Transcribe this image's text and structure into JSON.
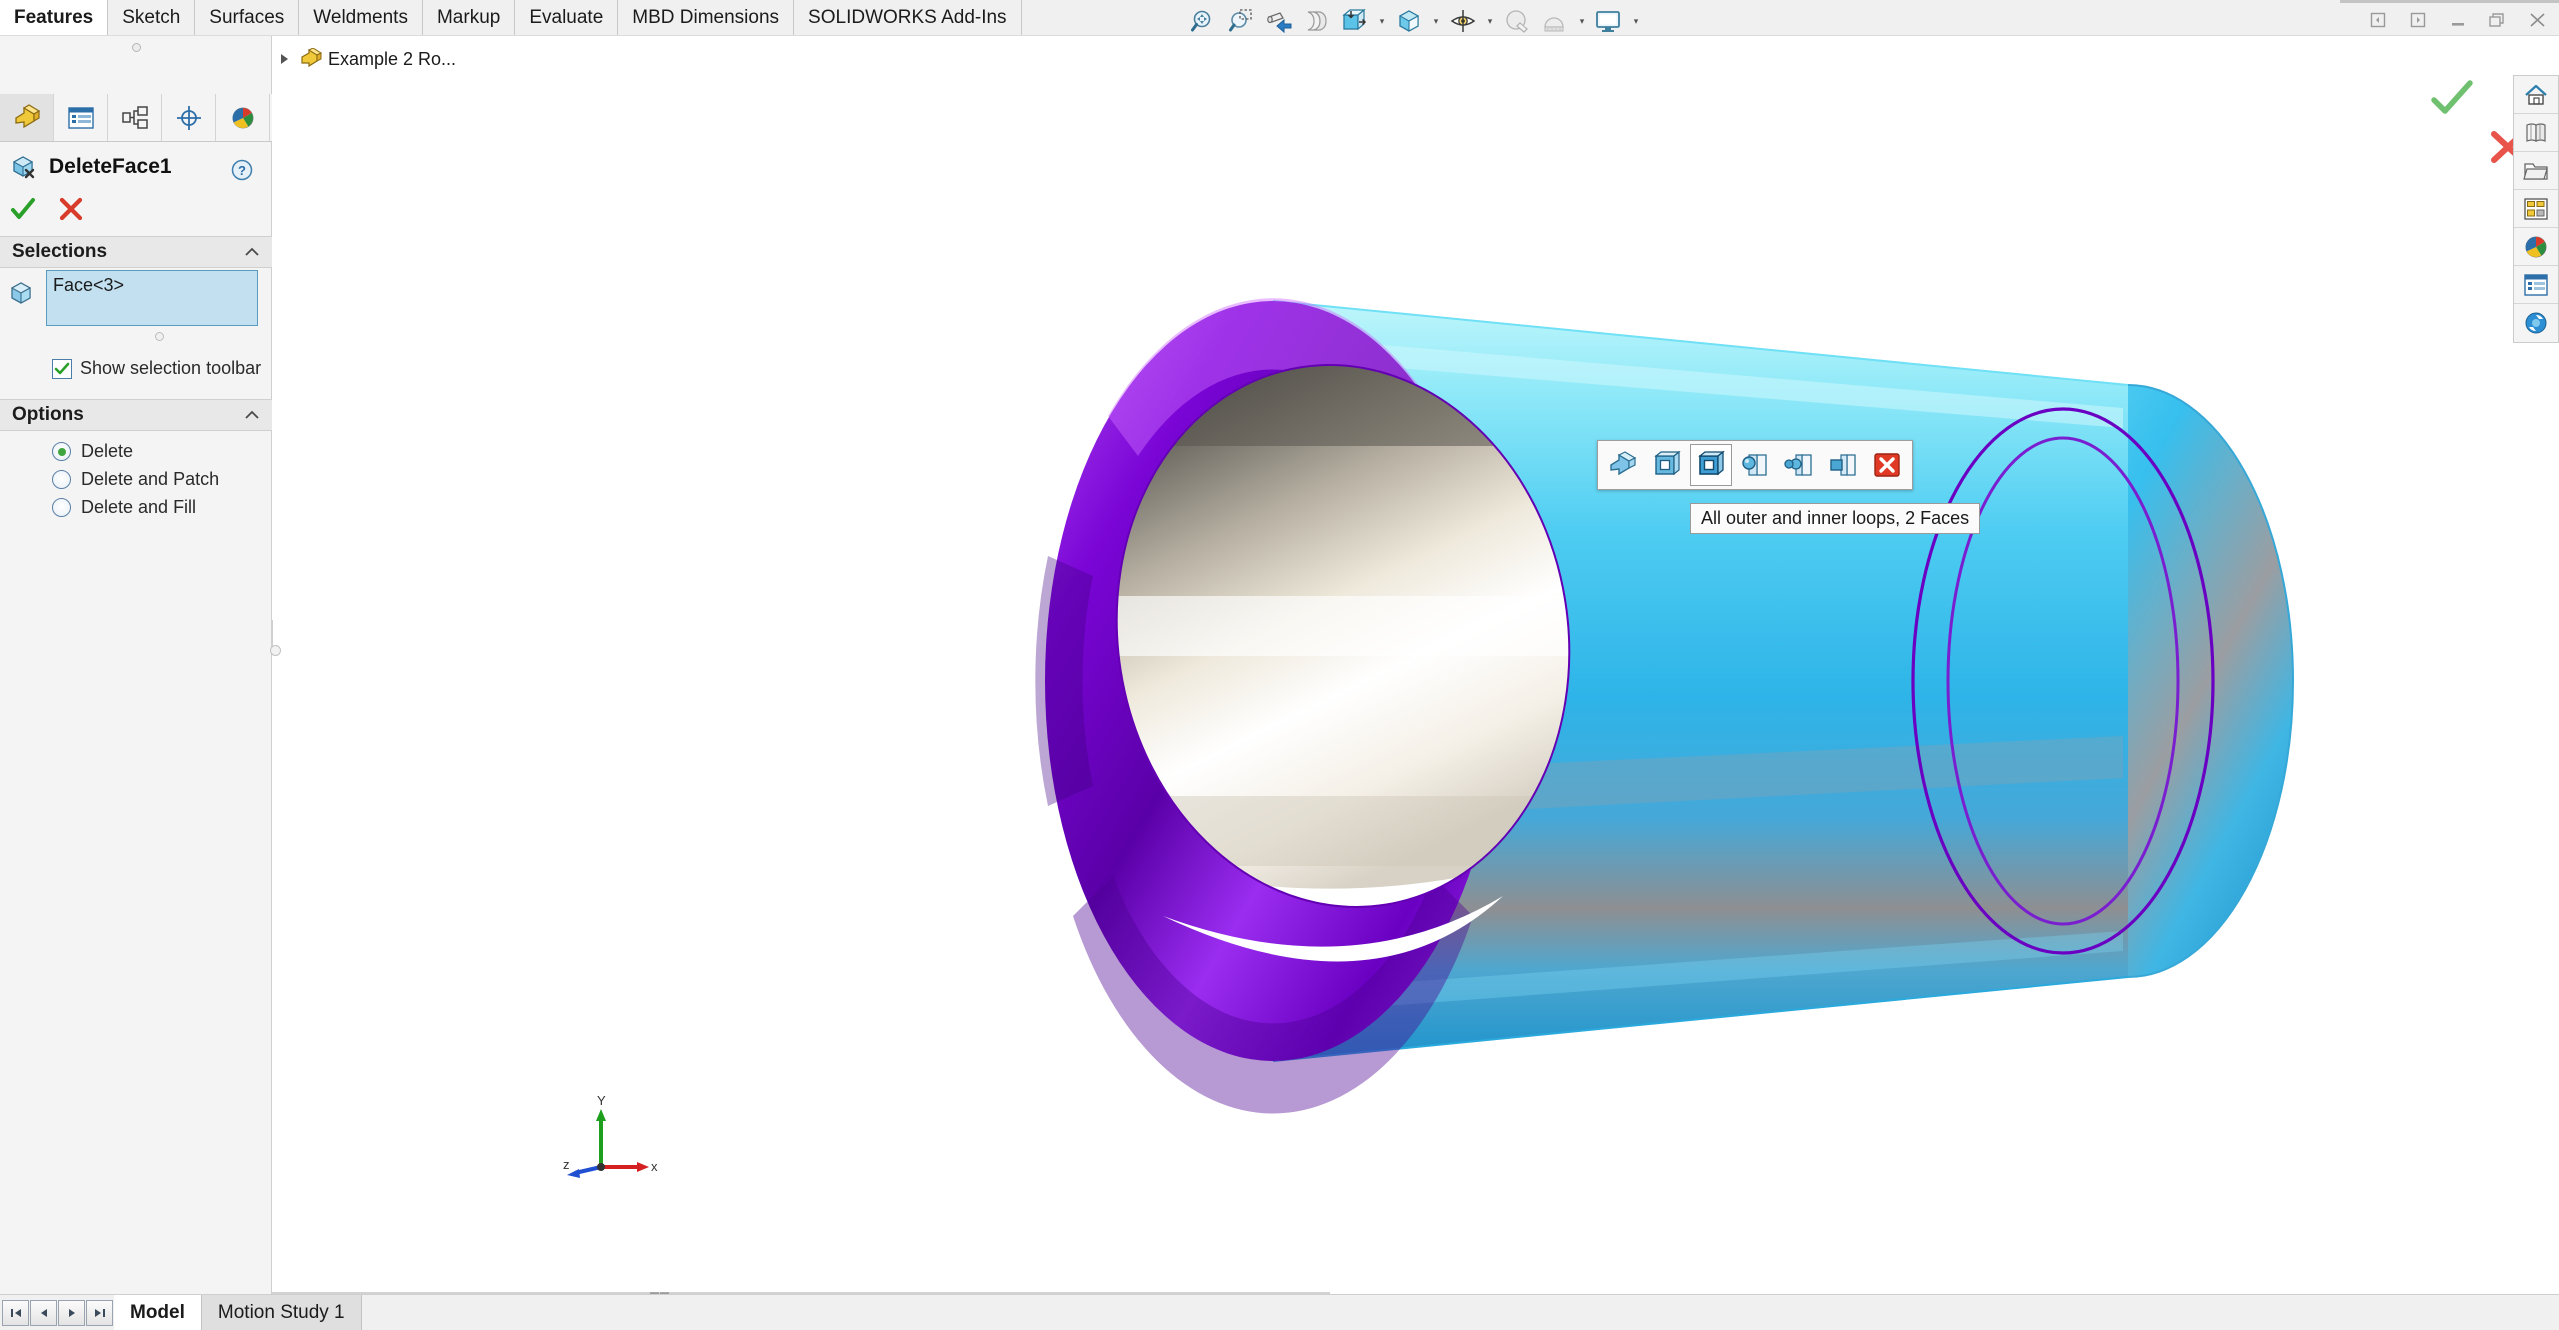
{
  "app": {
    "title": "SOLIDWORKS",
    "accent_color": "#2a6ea6"
  },
  "ribbon": {
    "tabs": [
      {
        "label": "Features",
        "active": true
      },
      {
        "label": "Sketch",
        "active": false
      },
      {
        "label": "Surfaces",
        "active": false
      },
      {
        "label": "Weldments",
        "active": false
      },
      {
        "label": "Markup",
        "active": false
      },
      {
        "label": "Evaluate",
        "active": false
      },
      {
        "label": "MBD Dimensions",
        "active": false
      },
      {
        "label": "SOLIDWORKS Add-Ins",
        "active": false
      }
    ]
  },
  "view_toolbar": {
    "buttons": [
      {
        "name": "zoom-to-fit-icon",
        "has_caret": false
      },
      {
        "name": "zoom-to-area-icon",
        "has_caret": false
      },
      {
        "name": "previous-view-icon",
        "has_caret": false
      },
      {
        "name": "section-view-icon",
        "has_caret": false
      },
      {
        "name": "view-orientation-icon",
        "has_caret": true
      },
      {
        "name": "display-style-icon",
        "has_caret": true
      },
      {
        "name": "hide-show-items-icon",
        "has_caret": true
      },
      {
        "name": "apply-scene-icon",
        "has_caret": false
      },
      {
        "name": "view-settings-icon",
        "has_caret": true
      },
      {
        "name": "viewport-layout-icon",
        "has_caret": true
      }
    ]
  },
  "window_controls": [
    {
      "name": "restore-left-icon",
      "label": ""
    },
    {
      "name": "restore-right-icon",
      "label": ""
    },
    {
      "name": "minimize-icon",
      "label": ""
    },
    {
      "name": "restore-down-icon",
      "label": ""
    },
    {
      "name": "close-icon",
      "label": ""
    }
  ],
  "property_manager": {
    "tabs": [
      {
        "name": "feature-manager-tab",
        "active": true
      },
      {
        "name": "property-manager-tab",
        "active": false
      },
      {
        "name": "configuration-manager-tab",
        "active": false
      },
      {
        "name": "dimxpert-manager-tab",
        "active": false
      },
      {
        "name": "display-manager-tab",
        "active": false
      }
    ],
    "title": "DeleteFace1",
    "help_label": "?",
    "confirm": {
      "ok_name": "ok-button",
      "cancel_name": "cancel-button"
    },
    "selections": {
      "header": "Selections",
      "face_value": "Face<3>",
      "show_selection_toolbar_label": "Show selection toolbar",
      "show_selection_toolbar_checked": true
    },
    "options": {
      "header": "Options",
      "items": [
        {
          "label": "Delete",
          "selected": true
        },
        {
          "label": "Delete and Patch",
          "selected": false
        },
        {
          "label": "Delete and Fill",
          "selected": false
        }
      ]
    }
  },
  "tree": {
    "item_label": "Example 2 Ro...",
    "expander": "▶"
  },
  "context_toolbar": {
    "buttons": [
      {
        "name": "select-other-icon",
        "selected": false
      },
      {
        "name": "select-loop-icon",
        "selected": false
      },
      {
        "name": "all-outer-inner-loops-icon",
        "selected": true
      },
      {
        "name": "select-tangency-icon",
        "selected": false
      },
      {
        "name": "select-partial-loop-icon",
        "selected": false
      },
      {
        "name": "select-connected-faces-icon",
        "selected": false
      },
      {
        "name": "close-toolbar-icon",
        "selected": false
      }
    ],
    "tooltip": "All outer and inner loops, 2 Faces"
  },
  "task_pane": {
    "buttons": [
      {
        "name": "solidworks-resources-icon"
      },
      {
        "name": "design-library-icon"
      },
      {
        "name": "file-explorer-icon"
      },
      {
        "name": "view-palette-icon"
      },
      {
        "name": "appearances-scenes-decals-icon"
      },
      {
        "name": "custom-properties-icon"
      },
      {
        "name": "solidworks-forum-icon"
      }
    ]
  },
  "triad": {
    "x_label": "x",
    "y_label": "Y",
    "z_label": "z"
  },
  "bottom_bar": {
    "nav_buttons": [
      {
        "name": "first-sheet-button",
        "glyph": "❘◀"
      },
      {
        "name": "previous-sheet-button",
        "glyph": "◀"
      },
      {
        "name": "next-sheet-button",
        "glyph": "▶"
      },
      {
        "name": "last-sheet-button",
        "glyph": "▶❘"
      }
    ],
    "tabs": [
      {
        "label": "Model",
        "active": true
      },
      {
        "label": "Motion Study 1",
        "active": false
      }
    ]
  },
  "model": {
    "description": "Purple/cyan shaded hollow cylindrical tube with selected faces highlighted",
    "selected_face_color": "#7d00d4",
    "body_color": "#46c8f0"
  }
}
